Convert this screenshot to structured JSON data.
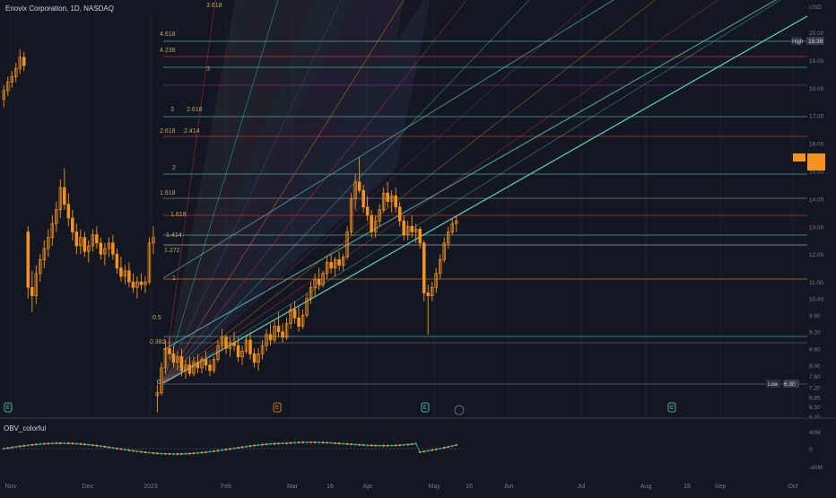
{
  "header": {
    "title": "Enovix Corporation, 1D, NASDAQ"
  },
  "indicator": {
    "title": "OBV_colorful",
    "ticks": [
      "40M",
      "0",
      "-40M"
    ]
  },
  "price_axis": {
    "unit": "USD",
    "labels": [
      "20.00",
      "19.00",
      "18.00",
      "17.00",
      "16.00",
      "15.00",
      "14.00",
      "13.00",
      "12.00",
      "11.00",
      "10.40",
      "9.80",
      "9.20",
      "8.60",
      "8.00",
      "7.60",
      "7.20",
      "6.85",
      "6.50",
      "6.15"
    ],
    "high_label": "High",
    "high_value": "19.39",
    "low_label": "Low",
    "low_value": "6.30"
  },
  "fib_labels": [
    "0",
    "0.382",
    "0.5",
    "1",
    "1.272",
    "1.414",
    "1.618",
    "1.618",
    "2",
    "2.414",
    "2.618",
    "2.618",
    "3",
    "3",
    "3.618",
    "4.236",
    "4.618"
  ],
  "time_axis": [
    "Nov",
    "Dec",
    "2023",
    "Feb",
    "Mar",
    "16",
    "Apr",
    "May",
    "16",
    "Jun",
    "Jul",
    "Aug",
    "16",
    "Sep",
    "Oct"
  ],
  "event_markers": [
    "E",
    "E",
    "E",
    "E"
  ],
  "colors": {
    "bg": "#131722",
    "candle": "#f7931a",
    "grid": "#1e222d",
    "fibLine": "#5fd3bc",
    "axis": "#787b86"
  },
  "chart_data": {
    "type": "candlestick",
    "title": "Enovix Corporation, 1D, NASDAQ",
    "y_unit": "USD",
    "ylim": [
      6.0,
      21.0
    ],
    "high": 19.39,
    "low": 6.3,
    "candles": [
      {
        "o": 17.6,
        "h": 18.1,
        "l": 17.3,
        "c": 17.9
      },
      {
        "o": 17.9,
        "h": 18.4,
        "l": 17.7,
        "c": 18.2
      },
      {
        "o": 18.2,
        "h": 18.6,
        "l": 18.0,
        "c": 18.4
      },
      {
        "o": 18.4,
        "h": 18.9,
        "l": 18.2,
        "c": 18.7
      },
      {
        "o": 18.7,
        "h": 19.39,
        "l": 18.5,
        "c": 19.1
      },
      {
        "o": 19.1,
        "h": 19.3,
        "l": 18.6,
        "c": 18.8
      },
      {
        "o": 12.8,
        "h": 13.0,
        "l": 10.4,
        "c": 10.8
      },
      {
        "o": 10.8,
        "h": 11.4,
        "l": 9.9,
        "c": 10.5
      },
      {
        "o": 10.5,
        "h": 11.6,
        "l": 10.2,
        "c": 11.3
      },
      {
        "o": 11.3,
        "h": 12.0,
        "l": 11.0,
        "c": 11.8
      },
      {
        "o": 11.8,
        "h": 12.5,
        "l": 11.5,
        "c": 12.2
      },
      {
        "o": 12.2,
        "h": 12.9,
        "l": 11.9,
        "c": 12.6
      },
      {
        "o": 12.6,
        "h": 13.4,
        "l": 12.3,
        "c": 13.1
      },
      {
        "o": 13.1,
        "h": 13.9,
        "l": 12.8,
        "c": 13.6
      },
      {
        "o": 13.6,
        "h": 14.7,
        "l": 13.3,
        "c": 14.4
      },
      {
        "o": 14.4,
        "h": 15.1,
        "l": 13.6,
        "c": 13.8
      },
      {
        "o": 13.8,
        "h": 14.2,
        "l": 13.0,
        "c": 13.3
      },
      {
        "o": 13.3,
        "h": 13.6,
        "l": 12.5,
        "c": 12.8
      },
      {
        "o": 12.8,
        "h": 13.1,
        "l": 12.0,
        "c": 12.3
      },
      {
        "o": 12.3,
        "h": 12.9,
        "l": 12.0,
        "c": 12.6
      },
      {
        "o": 12.6,
        "h": 12.8,
        "l": 11.9,
        "c": 12.1
      },
      {
        "o": 12.1,
        "h": 12.5,
        "l": 11.7,
        "c": 12.3
      },
      {
        "o": 12.3,
        "h": 12.9,
        "l": 12.1,
        "c": 12.7
      },
      {
        "o": 12.7,
        "h": 13.0,
        "l": 12.2,
        "c": 12.4
      },
      {
        "o": 12.4,
        "h": 12.6,
        "l": 11.8,
        "c": 12.0
      },
      {
        "o": 12.0,
        "h": 12.4,
        "l": 11.6,
        "c": 12.2
      },
      {
        "o": 12.2,
        "h": 12.6,
        "l": 11.9,
        "c": 12.4
      },
      {
        "o": 12.4,
        "h": 12.7,
        "l": 11.8,
        "c": 12.0
      },
      {
        "o": 12.0,
        "h": 12.2,
        "l": 11.3,
        "c": 11.5
      },
      {
        "o": 11.5,
        "h": 11.9,
        "l": 11.0,
        "c": 11.2
      },
      {
        "o": 11.2,
        "h": 11.6,
        "l": 10.9,
        "c": 11.4
      },
      {
        "o": 11.4,
        "h": 11.7,
        "l": 10.8,
        "c": 11.0
      },
      {
        "o": 11.0,
        "h": 11.3,
        "l": 10.6,
        "c": 10.8
      },
      {
        "o": 10.8,
        "h": 11.2,
        "l": 10.4,
        "c": 11.0
      },
      {
        "o": 11.0,
        "h": 11.3,
        "l": 10.7,
        "c": 10.9
      },
      {
        "o": 10.9,
        "h": 11.2,
        "l": 10.6,
        "c": 11.0
      },
      {
        "o": 11.0,
        "h": 12.6,
        "l": 10.9,
        "c": 12.4
      },
      {
        "o": 12.4,
        "h": 13.0,
        "l": 12.0,
        "c": 12.6
      },
      {
        "o": 6.9,
        "h": 7.3,
        "l": 6.3,
        "c": 7.0
      },
      {
        "o": 7.0,
        "h": 8.1,
        "l": 6.9,
        "c": 7.9
      },
      {
        "o": 7.9,
        "h": 8.9,
        "l": 7.7,
        "c": 8.6
      },
      {
        "o": 8.6,
        "h": 9.0,
        "l": 8.2,
        "c": 8.4
      },
      {
        "o": 8.4,
        "h": 8.7,
        "l": 7.9,
        "c": 8.1
      },
      {
        "o": 8.1,
        "h": 8.5,
        "l": 7.8,
        "c": 8.3
      },
      {
        "o": 8.3,
        "h": 8.6,
        "l": 7.6,
        "c": 7.8
      },
      {
        "o": 7.8,
        "h": 8.2,
        "l": 7.5,
        "c": 8.0
      },
      {
        "o": 8.0,
        "h": 8.3,
        "l": 7.6,
        "c": 7.7
      },
      {
        "o": 7.7,
        "h": 8.3,
        "l": 7.6,
        "c": 8.1
      },
      {
        "o": 8.1,
        "h": 8.4,
        "l": 7.7,
        "c": 7.9
      },
      {
        "o": 7.9,
        "h": 8.3,
        "l": 7.7,
        "c": 8.2
      },
      {
        "o": 8.2,
        "h": 8.5,
        "l": 7.8,
        "c": 8.0
      },
      {
        "o": 8.0,
        "h": 8.2,
        "l": 7.6,
        "c": 7.8
      },
      {
        "o": 7.8,
        "h": 8.3,
        "l": 7.7,
        "c": 8.2
      },
      {
        "o": 8.2,
        "h": 8.9,
        "l": 8.1,
        "c": 8.7
      },
      {
        "o": 8.7,
        "h": 9.3,
        "l": 8.5,
        "c": 9.0
      },
      {
        "o": 9.0,
        "h": 9.1,
        "l": 8.4,
        "c": 8.6
      },
      {
        "o": 8.6,
        "h": 9.0,
        "l": 8.3,
        "c": 8.8
      },
      {
        "o": 8.8,
        "h": 9.2,
        "l": 8.5,
        "c": 8.7
      },
      {
        "o": 8.7,
        "h": 9.0,
        "l": 8.1,
        "c": 8.3
      },
      {
        "o": 8.3,
        "h": 8.7,
        "l": 8.0,
        "c": 8.5
      },
      {
        "o": 8.5,
        "h": 9.1,
        "l": 8.4,
        "c": 8.9
      },
      {
        "o": 8.9,
        "h": 9.2,
        "l": 8.2,
        "c": 8.4
      },
      {
        "o": 8.4,
        "h": 8.6,
        "l": 7.9,
        "c": 8.1
      },
      {
        "o": 8.1,
        "h": 8.6,
        "l": 7.8,
        "c": 8.4
      },
      {
        "o": 8.4,
        "h": 8.9,
        "l": 8.2,
        "c": 8.7
      },
      {
        "o": 8.7,
        "h": 9.3,
        "l": 8.5,
        "c": 9.1
      },
      {
        "o": 9.1,
        "h": 9.5,
        "l": 8.7,
        "c": 8.9
      },
      {
        "o": 8.9,
        "h": 9.6,
        "l": 8.8,
        "c": 9.4
      },
      {
        "o": 9.4,
        "h": 9.9,
        "l": 9.0,
        "c": 9.2
      },
      {
        "o": 9.2,
        "h": 9.5,
        "l": 8.8,
        "c": 9.0
      },
      {
        "o": 9.0,
        "h": 9.7,
        "l": 8.9,
        "c": 9.5
      },
      {
        "o": 9.5,
        "h": 10.2,
        "l": 9.3,
        "c": 10.0
      },
      {
        "o": 10.0,
        "h": 10.3,
        "l": 9.5,
        "c": 9.7
      },
      {
        "o": 9.7,
        "h": 10.1,
        "l": 9.2,
        "c": 9.4
      },
      {
        "o": 9.4,
        "h": 10.0,
        "l": 9.3,
        "c": 9.8
      },
      {
        "o": 9.8,
        "h": 10.6,
        "l": 9.7,
        "c": 10.4
      },
      {
        "o": 10.4,
        "h": 11.0,
        "l": 10.2,
        "c": 10.8
      },
      {
        "o": 10.8,
        "h": 11.3,
        "l": 10.5,
        "c": 11.1
      },
      {
        "o": 11.1,
        "h": 11.5,
        "l": 10.7,
        "c": 10.9
      },
      {
        "o": 10.9,
        "h": 11.4,
        "l": 10.8,
        "c": 11.3
      },
      {
        "o": 11.3,
        "h": 11.9,
        "l": 11.1,
        "c": 11.7
      },
      {
        "o": 11.7,
        "h": 12.0,
        "l": 11.3,
        "c": 11.5
      },
      {
        "o": 11.5,
        "h": 11.9,
        "l": 11.2,
        "c": 11.8
      },
      {
        "o": 11.8,
        "h": 12.1,
        "l": 11.4,
        "c": 11.6
      },
      {
        "o": 11.6,
        "h": 12.0,
        "l": 11.4,
        "c": 11.9
      },
      {
        "o": 11.9,
        "h": 13.0,
        "l": 11.8,
        "c": 12.8
      },
      {
        "o": 12.8,
        "h": 14.2,
        "l": 12.7,
        "c": 14.0
      },
      {
        "o": 14.0,
        "h": 14.9,
        "l": 13.6,
        "c": 14.6
      },
      {
        "o": 14.6,
        "h": 15.5,
        "l": 14.2,
        "c": 14.3
      },
      {
        "o": 14.3,
        "h": 14.5,
        "l": 13.5,
        "c": 13.7
      },
      {
        "o": 13.7,
        "h": 14.1,
        "l": 13.2,
        "c": 13.4
      },
      {
        "o": 13.4,
        "h": 13.6,
        "l": 12.6,
        "c": 12.8
      },
      {
        "o": 12.8,
        "h": 13.4,
        "l": 12.6,
        "c": 13.2
      },
      {
        "o": 13.2,
        "h": 13.8,
        "l": 13.0,
        "c": 13.6
      },
      {
        "o": 13.6,
        "h": 14.4,
        "l": 13.5,
        "c": 14.2
      },
      {
        "o": 14.2,
        "h": 14.6,
        "l": 13.7,
        "c": 13.9
      },
      {
        "o": 13.9,
        "h": 14.3,
        "l": 13.5,
        "c": 14.1
      },
      {
        "o": 14.1,
        "h": 14.4,
        "l": 13.5,
        "c": 13.7
      },
      {
        "o": 13.7,
        "h": 13.9,
        "l": 13.0,
        "c": 13.2
      },
      {
        "o": 13.2,
        "h": 13.4,
        "l": 12.5,
        "c": 12.7
      },
      {
        "o": 12.7,
        "h": 13.2,
        "l": 12.5,
        "c": 13.0
      },
      {
        "o": 13.0,
        "h": 13.4,
        "l": 12.6,
        "c": 12.8
      },
      {
        "o": 12.8,
        "h": 13.1,
        "l": 12.4,
        "c": 12.9
      },
      {
        "o": 12.9,
        "h": 13.0,
        "l": 12.2,
        "c": 12.4
      },
      {
        "o": 12.4,
        "h": 12.5,
        "l": 10.3,
        "c": 10.6
      },
      {
        "o": 10.6,
        "h": 10.9,
        "l": 9.1,
        "c": 10.5
      },
      {
        "o": 10.5,
        "h": 11.0,
        "l": 10.3,
        "c": 10.8
      },
      {
        "o": 10.8,
        "h": 11.5,
        "l": 10.6,
        "c": 11.3
      },
      {
        "o": 11.3,
        "h": 12.0,
        "l": 11.1,
        "c": 11.8
      },
      {
        "o": 11.8,
        "h": 12.6,
        "l": 11.7,
        "c": 12.4
      },
      {
        "o": 12.4,
        "h": 13.0,
        "l": 12.2,
        "c": 12.8
      },
      {
        "o": 12.8,
        "h": 13.3,
        "l": 12.7,
        "c": 13.1
      },
      {
        "o": 13.1,
        "h": 13.4,
        "l": 12.8,
        "c": 13.2
      }
    ],
    "obv_ylim": [
      -55,
      55
    ]
  }
}
